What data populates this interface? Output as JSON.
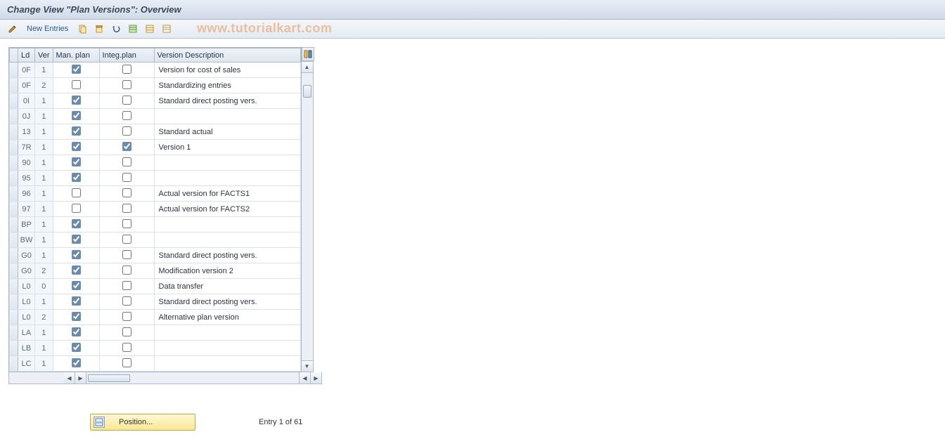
{
  "window": {
    "title": "Change View \"Plan Versions\": Overview"
  },
  "toolbar": {
    "new_entries_label": "New Entries",
    "icons": {
      "toggle": "toggle-icon",
      "copy": "copy-icon",
      "delete": "delete-icon",
      "undo": "undo-icon",
      "select_all": "select-all-icon",
      "deselect_all": "deselect-all-icon",
      "table": "table-icon"
    }
  },
  "watermark": "www.tutorialkart.com",
  "columns": {
    "ld": "Ld",
    "ver": "Ver",
    "man_plan": "Man. plan",
    "integ_plan": "Integ.plan",
    "description": "Version Description"
  },
  "rows": [
    {
      "ld": "0F",
      "ver": "1",
      "man": true,
      "integ": false,
      "desc": "Version for cost of sales"
    },
    {
      "ld": "0F",
      "ver": "2",
      "man": false,
      "integ": false,
      "desc": "Standardizing entries"
    },
    {
      "ld": "0I",
      "ver": "1",
      "man": true,
      "integ": false,
      "desc": "Standard direct posting vers."
    },
    {
      "ld": "0J",
      "ver": "1",
      "man": true,
      "integ": false,
      "desc": ""
    },
    {
      "ld": "13",
      "ver": "1",
      "man": true,
      "integ": false,
      "desc": "Standard actual"
    },
    {
      "ld": "7R",
      "ver": "1",
      "man": true,
      "integ": true,
      "desc": "Version 1"
    },
    {
      "ld": "90",
      "ver": "1",
      "man": true,
      "integ": false,
      "desc": ""
    },
    {
      "ld": "95",
      "ver": "1",
      "man": true,
      "integ": false,
      "desc": ""
    },
    {
      "ld": "96",
      "ver": "1",
      "man": false,
      "integ": false,
      "desc": "Actual version for FACTS1"
    },
    {
      "ld": "97",
      "ver": "1",
      "man": false,
      "integ": false,
      "desc": "Actual version for FACTS2"
    },
    {
      "ld": "BP",
      "ver": "1",
      "man": true,
      "integ": false,
      "desc": ""
    },
    {
      "ld": "BW",
      "ver": "1",
      "man": true,
      "integ": false,
      "desc": ""
    },
    {
      "ld": "G0",
      "ver": "1",
      "man": true,
      "integ": false,
      "desc": "Standard direct posting vers."
    },
    {
      "ld": "G0",
      "ver": "2",
      "man": true,
      "integ": false,
      "desc": "Modification version 2"
    },
    {
      "ld": "L0",
      "ver": "0",
      "man": true,
      "integ": false,
      "desc": "Data transfer"
    },
    {
      "ld": "L0",
      "ver": "1",
      "man": true,
      "integ": false,
      "desc": "Standard direct posting vers."
    },
    {
      "ld": "L0",
      "ver": "2",
      "man": true,
      "integ": false,
      "desc": "Alternative plan version"
    },
    {
      "ld": "LA",
      "ver": "1",
      "man": true,
      "integ": false,
      "desc": ""
    },
    {
      "ld": "LB",
      "ver": "1",
      "man": true,
      "integ": false,
      "desc": ""
    },
    {
      "ld": "LC",
      "ver": "1",
      "man": true,
      "integ": false,
      "desc": ""
    }
  ],
  "footer": {
    "position_label": "Position...",
    "entry_status": "Entry 1 of 61"
  },
  "colors": {
    "header_gradient_top": "#e8eef5",
    "header_gradient_bottom": "#d0dae8",
    "grid_border": "#a8b4c4",
    "readonly_cell": "#f3f6fa"
  }
}
